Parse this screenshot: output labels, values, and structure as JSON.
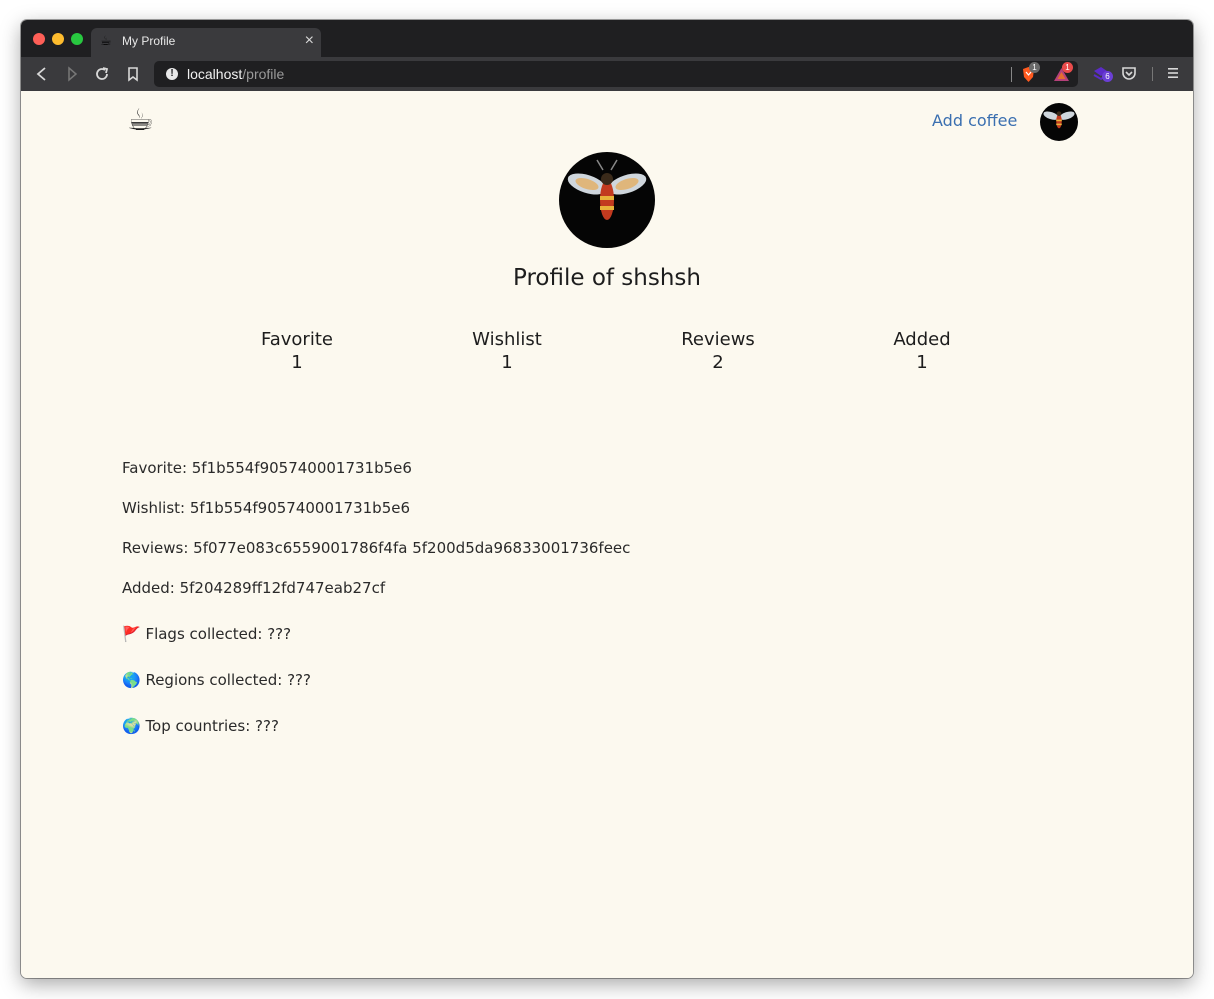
{
  "browser": {
    "tab": {
      "title": "My Profile",
      "favicon": "coffee-cup-icon"
    },
    "url": {
      "host": "localhost",
      "path": "/profile"
    },
    "extensions": [
      {
        "name": "brave-shield-icon",
        "badge": "1",
        "color": "#ff5a1f"
      },
      {
        "name": "brave-rewards-icon",
        "badge": "1",
        "color": "#e94b4b"
      },
      {
        "name": "extension-icon",
        "badge": "6",
        "color": "#6b3fd6"
      }
    ]
  },
  "header": {
    "logo": "☕",
    "add_coffee": "Add coffee"
  },
  "profile": {
    "title": "Profile of shshsh",
    "stats": [
      {
        "label": "Favorite",
        "value": "1"
      },
      {
        "label": "Wishlist",
        "value": "1"
      },
      {
        "label": "Reviews",
        "value": "2"
      },
      {
        "label": "Added",
        "value": "1"
      }
    ],
    "details": [
      {
        "text": "Favorite: 5f1b554f905740001731b5e6"
      },
      {
        "text": "Wishlist: 5f1b554f905740001731b5e6"
      },
      {
        "text": "Reviews: 5f077e083c6559001786f4fa 5f200d5da96833001736feec"
      },
      {
        "text": "Added: 5f204289ff12fd747eab27cf"
      },
      {
        "text": "🚩 Flags collected: ???"
      },
      {
        "text": "🌎 Regions collected: ???"
      },
      {
        "text": "🌍 Top countries: ???"
      }
    ]
  }
}
